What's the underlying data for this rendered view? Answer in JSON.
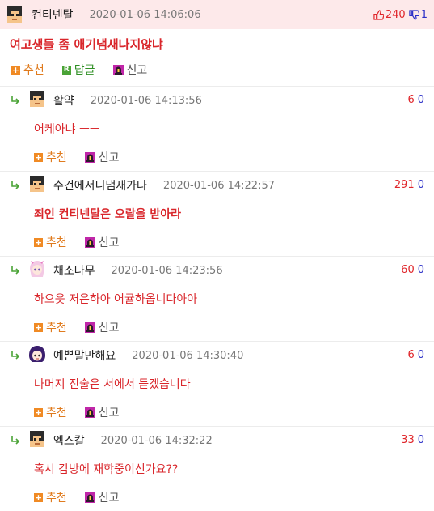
{
  "post": {
    "author": "컨티넨탈",
    "date": "2020-01-06 14:06:06",
    "upvotes": "240",
    "downvotes": "1",
    "title": "여고생들 좀 애기냄새나지않냐",
    "actions": {
      "recommend": "추천",
      "reply": "답글",
      "report": "신고"
    },
    "reply_icon_letter": "R"
  },
  "comments": [
    {
      "author": "활약",
      "date": "2020-01-06 14:13:56",
      "up": "6",
      "down": "0",
      "text": "어케아냐 ㅡㅡ",
      "bold": false,
      "avatar": "pixel-man-avatar"
    },
    {
      "author": "수건에서니냄새가나",
      "date": "2020-01-06 14:22:57",
      "up": "291",
      "down": "0",
      "text": "죄인 컨티넨탈은 오랄을 받아라",
      "bold": true,
      "avatar": "pixel-man-avatar"
    },
    {
      "author": "채소나무",
      "date": "2020-01-06 14:23:56",
      "up": "60",
      "down": "0",
      "text": "하으읏 저은하아 어귤하옵니다아아",
      "bold": false,
      "avatar": "anime-girl-avatar"
    },
    {
      "author": "예쁜말만해요",
      "date": "2020-01-06 14:30:40",
      "up": "6",
      "down": "0",
      "text": "나머지 진술은 서에서 듣겠습니다",
      "bold": false,
      "avatar": "purple-hair-avatar"
    },
    {
      "author": "엑스칼",
      "date": "2020-01-06 14:32:22",
      "up": "33",
      "down": "0",
      "text": "혹시 감방에 재학중이신가요??",
      "bold": false,
      "avatar": "pixel-man-avatar"
    }
  ],
  "comment_actions": {
    "recommend": "추천",
    "report": "신고"
  },
  "colors": {
    "accent_red": "#d9262b",
    "header_bg": "#fde9ea",
    "down_blue": "#2b2fc7",
    "recommend_orange": "#f08a24",
    "reply_green": "#4aa336"
  }
}
